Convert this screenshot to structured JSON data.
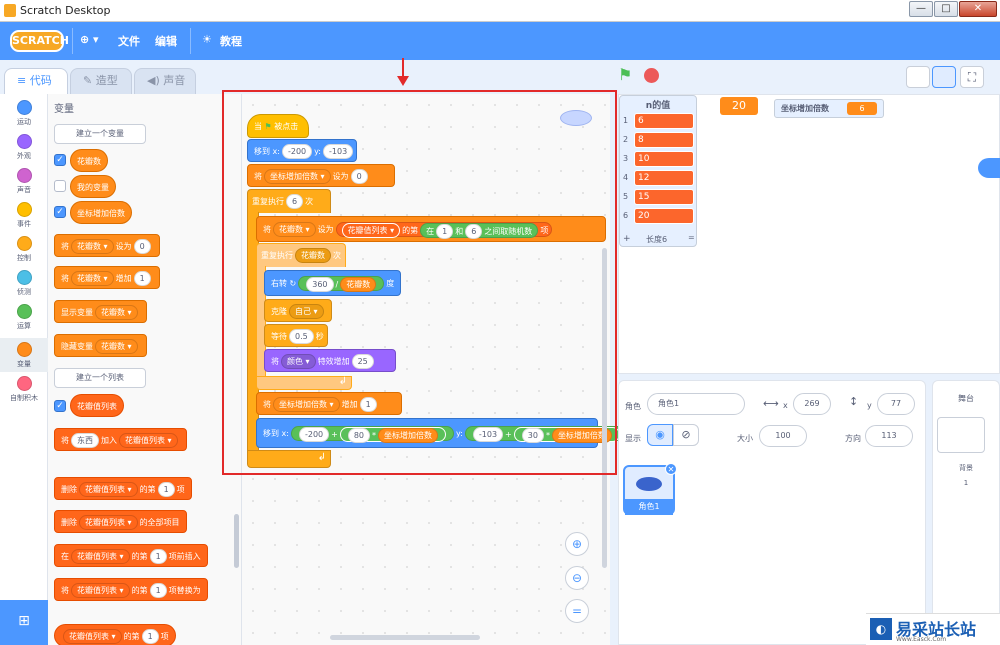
{
  "window": {
    "title": "Scratch Desktop",
    "minimize": "—",
    "maximize": "□",
    "close": "✕"
  },
  "menu": {
    "logo": "SCRATCH",
    "globe": "⊕ ▾",
    "file": "文件",
    "edit": "编辑",
    "tutorials": "教程"
  },
  "tabs": {
    "code": "代码",
    "costumes": "造型",
    "sounds": "声音"
  },
  "categories": [
    {
      "label": "运动",
      "color": "#4c97ff"
    },
    {
      "label": "外观",
      "color": "#9966ff"
    },
    {
      "label": "声音",
      "color": "#cf63cf"
    },
    {
      "label": "事件",
      "color": "#ffbf00"
    },
    {
      "label": "控制",
      "color": "#ffab19"
    },
    {
      "label": "侦测",
      "color": "#4cbfe6"
    },
    {
      "label": "运算",
      "color": "#59c059"
    },
    {
      "label": "变量",
      "color": "#ff8c1a"
    },
    {
      "label": "自制积木",
      "color": "#ff6680"
    }
  ],
  "palette": {
    "heading": "变量",
    "make_var": "建立一个变量",
    "vars": [
      "花瓣数",
      "我的变量",
      "坐标增加倍数"
    ],
    "set_blk": {
      "verb": "将",
      "var": "花瓣数 ▾",
      "to": "设为",
      "val": "0"
    },
    "change_blk": {
      "verb": "将",
      "var": "花瓣数 ▾",
      "by": "增加",
      "val": "1"
    },
    "show_blk": {
      "verb": "显示变量",
      "var": "花瓣数 ▾"
    },
    "hide_blk": {
      "verb": "隐藏变量",
      "var": "花瓣数 ▾"
    },
    "make_list": "建立一个列表",
    "list_name": "花瓣值列表",
    "add_blk": {
      "verb": "将",
      "thing": "东西",
      "add": "加入",
      "list": "花瓣值列表 ▾"
    },
    "del_blk": {
      "verb": "删除",
      "list": "花瓣值列表 ▾",
      "of": "的第",
      "n": "1",
      "item": "项"
    },
    "delall_blk": {
      "verb": "删除",
      "list": "花瓣值列表 ▾",
      "all": "的全部项目"
    },
    "insert_blk": {
      "verb": "在",
      "list": "花瓣值列表 ▾",
      "of": "的第",
      "n": "1",
      "rest": "项前插入"
    },
    "replace_blk": {
      "verb": "将",
      "list": "花瓣值列表 ▾",
      "of": "的第",
      "n": "1",
      "rest": "项替换为"
    },
    "item_blk": {
      "list": "花瓣值列表 ▾",
      "of": "的第",
      "n": "1",
      "item": "项"
    }
  },
  "script": {
    "hat": {
      "when": "当",
      "flag": "⚑",
      "clicked": "被点击"
    },
    "goto": {
      "label": "移到 x:",
      "x": "-200",
      "ylabel": "y:",
      "y": "-103"
    },
    "set_mult": {
      "verb": "将",
      "var": "坐标增加倍数 ▾",
      "to": "设为",
      "val": "0"
    },
    "repeat1": {
      "label": "重复执行",
      "n": "6",
      "times": "次"
    },
    "set_petal": {
      "verb": "将",
      "var": "花瓣数 ▾",
      "to": "设为",
      "list": "花瓣值列表 ▾",
      "of": "的第",
      "in": "在",
      "a": "1",
      "and": "和",
      "b": "6",
      "between": "之间取随机数",
      "item": "项"
    },
    "repeat2": {
      "label": "重复执行",
      "var": "花瓣数",
      "times": "次"
    },
    "turn": {
      "label": "右转 ↻",
      "a": "360",
      "div": "/",
      "var": "花瓣数",
      "deg": "度"
    },
    "clone": {
      "label": "克隆",
      "target": "自己 ▾"
    },
    "wait": {
      "label": "等待",
      "val": "0.5",
      "sec": "秒"
    },
    "effect": {
      "verb": "将",
      "effect": "颜色 ▾",
      "change": "特效增加",
      "val": "25"
    },
    "change_mult": {
      "verb": "将",
      "var": "坐标增加倍数 ▾",
      "by": "增加",
      "val": "1"
    },
    "goto2": {
      "label": "移到 x:",
      "x0": "-200",
      "plus": "+",
      "k": "80",
      "times": "*",
      "var": "坐标增加倍数",
      "ylabel": "y:",
      "y0": "-103",
      "plus2": "+",
      "k2": "30",
      "times2": "*",
      "var2": "坐标增加倍数"
    },
    "loop_arrow": "↲"
  },
  "stage": {
    "list_title": "n的值",
    "list_items": [
      "6",
      "8",
      "10",
      "12",
      "15",
      "20"
    ],
    "list_indices": [
      "1",
      "2",
      "3",
      "4",
      "5",
      "6"
    ],
    "list_add": "+",
    "list_length": "长度6",
    "list_eq": "=",
    "counter": "20",
    "var_monitor_label": "坐标增加倍数",
    "var_monitor_value": "6"
  },
  "sprite": {
    "sprite_label": "角色",
    "sprite_name": "角色1",
    "x_label": "x",
    "x": "269",
    "y_label": "y",
    "y": "77",
    "show_label": "显示",
    "size_label": "大小",
    "size": "100",
    "dir_label": "方向",
    "dir": "113",
    "thumb_name": "角色1"
  },
  "stage_panel": {
    "title": "舞台",
    "backdrop_label": "背景",
    "backdrop_count": "1"
  },
  "watermark": {
    "text": "易采站长站",
    "sub": "Www.Easck.Com"
  },
  "colors": {
    "accent": "#4c97ff",
    "highlight": "#e22a2a",
    "variable": "#ff8c1a",
    "list": "#ff661a"
  }
}
